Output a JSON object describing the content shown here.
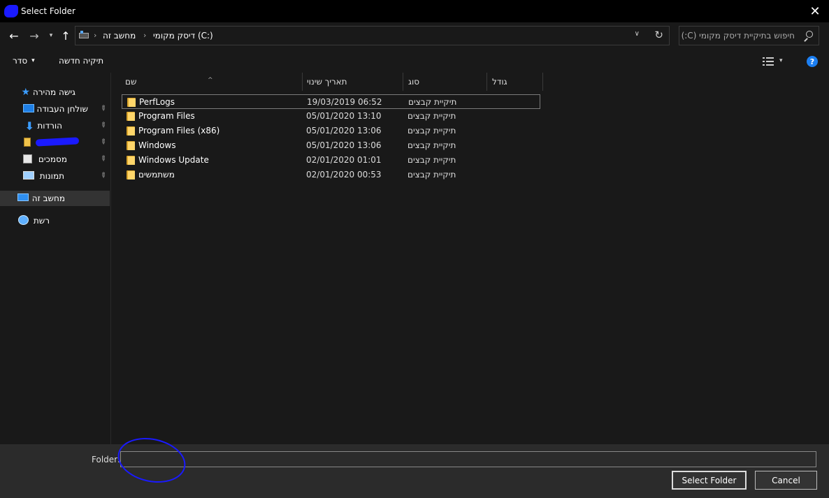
{
  "window": {
    "title": "Select Folder",
    "close_glyph": "✕"
  },
  "nav": {
    "back_glyph": "←",
    "forward_glyph": "→",
    "recent_glyph": "▾",
    "up_glyph": "↑"
  },
  "address": {
    "crumbs": [
      "מחשב זה",
      "דיסק מקומי (C:)"
    ],
    "dropdown_glyph": "∨",
    "refresh_glyph": "↻"
  },
  "search": {
    "placeholder": "חיפוש בתיקיית  דיסק מקומי (C:)"
  },
  "commands": {
    "organize_label": "סדר",
    "organize_caret": "▾",
    "new_folder_label": "תיקיה חדשה",
    "view_caret": "▾",
    "help_glyph": "?"
  },
  "sidebar": {
    "quick_access": "גישה מהירה",
    "items": [
      {
        "label": "שולחן העבודה",
        "icon": "desktop-icon",
        "pinned": true
      },
      {
        "label": "הורדות",
        "icon": "downloads-icon",
        "pinned": true
      },
      {
        "label": "",
        "icon": "redacted-folder-icon",
        "pinned": true
      },
      {
        "label": "מסמכים",
        "icon": "documents-icon",
        "pinned": true
      },
      {
        "label": "תמונות",
        "icon": "pictures-icon",
        "pinned": true
      }
    ],
    "this_pc": "מחשב זה",
    "network": "רשת",
    "pin_glyph": "📌"
  },
  "columns": {
    "name": "שם",
    "date": "תאריך שינוי",
    "type": "סוג",
    "size": "גודל",
    "sort_glyph": "^"
  },
  "files": [
    {
      "name": "PerfLogs",
      "date": "19/03/2019 06:52",
      "type": "תיקיית קבצים"
    },
    {
      "name": "Program Files",
      "date": "05/01/2020 13:10",
      "type": "תיקיית קבצים"
    },
    {
      "name": "Program Files (x86)",
      "date": "05/01/2020 13:06",
      "type": "תיקיית קבצים"
    },
    {
      "name": "Windows",
      "date": "05/01/2020 13:06",
      "type": "תיקיית קבצים"
    },
    {
      "name": "Windows Update",
      "date": "02/01/2020 01:01",
      "type": "תיקיית קבצים"
    },
    {
      "name": "משתמשים",
      "date": "02/01/2020 00:53",
      "type": "תיקיית קבצים"
    }
  ],
  "footer": {
    "folder_label": "Folder:",
    "folder_value": "",
    "select_button": "Select Folder",
    "cancel_button": "Cancel"
  }
}
